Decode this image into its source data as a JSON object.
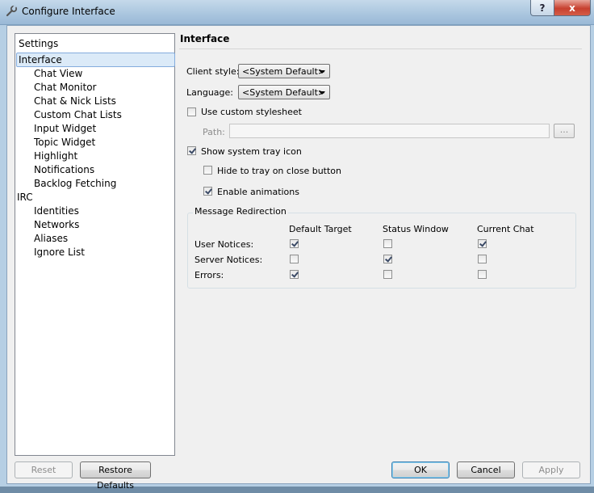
{
  "window": {
    "title": "Configure Interface",
    "help_label": "?",
    "close_label": "x"
  },
  "tree": {
    "items": [
      {
        "label": "Settings",
        "level": 0
      },
      {
        "label": "Interface",
        "level": 0,
        "selected": true
      },
      {
        "label": "Chat View",
        "level": 1
      },
      {
        "label": "Chat Monitor",
        "level": 1
      },
      {
        "label": "Chat & Nick Lists",
        "level": 1
      },
      {
        "label": "Custom Chat Lists",
        "level": 1
      },
      {
        "label": "Input Widget",
        "level": 1
      },
      {
        "label": "Topic Widget",
        "level": 1
      },
      {
        "label": "Highlight",
        "level": 1
      },
      {
        "label": "Notifications",
        "level": 1
      },
      {
        "label": "Backlog Fetching",
        "level": 1
      },
      {
        "label": "IRC",
        "level": 0
      },
      {
        "label": "Identities",
        "level": 1
      },
      {
        "label": "Networks",
        "level": 1
      },
      {
        "label": "Aliases",
        "level": 1
      },
      {
        "label": "Ignore List",
        "level": 1
      }
    ]
  },
  "panel": {
    "title": "Interface",
    "client_style": {
      "label": "Client style:",
      "value": "<System Default>"
    },
    "language": {
      "label": "Language:",
      "value": "<System Default>"
    },
    "custom_stylesheet": {
      "label": "Use custom stylesheet",
      "checked": false
    },
    "path": {
      "label": "Path:",
      "value": "",
      "browse_label": "..."
    },
    "system_tray": {
      "label": "Show system tray icon",
      "checked": true
    },
    "hide_to_tray": {
      "label": "Hide to tray on close button",
      "checked": false
    },
    "animations": {
      "label": "Enable animations",
      "checked": true
    },
    "redirection": {
      "title": "Message Redirection",
      "columns": [
        "Default Target",
        "Status Window",
        "Current Chat"
      ],
      "rows": [
        {
          "label": "User Notices:",
          "values": [
            true,
            false,
            true
          ]
        },
        {
          "label": "Server Notices:",
          "values": [
            false,
            true,
            false
          ]
        },
        {
          "label": "Errors:",
          "values": [
            true,
            false,
            false
          ]
        }
      ]
    }
  },
  "buttons": {
    "reset": "Reset",
    "restore_defaults": "Restore Defaults",
    "ok": "OK",
    "cancel": "Cancel",
    "apply": "Apply"
  }
}
